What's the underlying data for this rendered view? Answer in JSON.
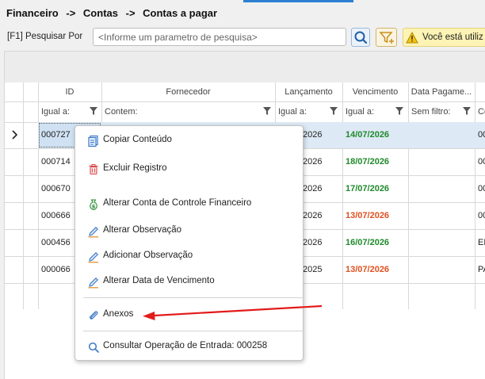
{
  "breadcrumb": {
    "part1": "Financeiro",
    "sep1": "->",
    "part2": "Contas",
    "sep2": "->",
    "part3": "Contas a pagar"
  },
  "search": {
    "label": "[F1] Pesquisar Por",
    "placeholder": "<Informe um parametro de pesquisa>",
    "value": ""
  },
  "toolbar": {
    "search_icon": "search-icon",
    "filter_icon": "filter-add-icon"
  },
  "warning": {
    "icon": "warning-icon",
    "text": "Você está utiliz"
  },
  "grid": {
    "headers": [
      "ID",
      "Fornecedor",
      "Lançamento",
      "Vencimento",
      "Data Pagame...",
      ""
    ],
    "filters": [
      "Igual a:",
      "Contem:",
      "Igual a:",
      "Igual a:",
      "Sem filtro:",
      "Co"
    ],
    "rows": [
      {
        "id": "000727",
        "lancamento": "2026",
        "vencimento": "14/07/2026",
        "venc_status": "green",
        "extra": "00"
      },
      {
        "id": "000714",
        "lancamento": "2026",
        "vencimento": "18/07/2026",
        "venc_status": "green",
        "extra": "00"
      },
      {
        "id": "000670",
        "lancamento": "2026",
        "vencimento": "17/07/2026",
        "venc_status": "green",
        "extra": "00"
      },
      {
        "id": "000666",
        "lancamento": "2026",
        "vencimento": "13/07/2026",
        "venc_status": "orange",
        "extra": "00"
      },
      {
        "id": "000456",
        "lancamento": "2026",
        "vencimento": "16/07/2026",
        "venc_status": "green",
        "extra": "EN"
      },
      {
        "id": "000066",
        "lancamento": "2025",
        "vencimento": "13/07/2026",
        "venc_status": "orange",
        "extra": "PA"
      }
    ]
  },
  "context_menu": {
    "items": [
      {
        "label": "Copiar Conteúdo",
        "icon": "copy-icon"
      },
      {
        "label": "Excluir Registro",
        "icon": "trash-icon"
      },
      {
        "label": "Alterar Conta de Controle Financeiro",
        "icon": "money-bag-icon"
      },
      {
        "label": "Alterar Observação",
        "icon": "pencil-icon"
      },
      {
        "label": "Adicionar Observação",
        "icon": "pencil-icon"
      },
      {
        "label": "Alterar Data de Vencimento",
        "icon": "pencil-icon"
      },
      {
        "label": "Anexos",
        "icon": "paperclip-icon"
      },
      {
        "label": "Consultar Operação de Entrada: 000258",
        "icon": "search-icon"
      }
    ]
  },
  "colors": {
    "accent": "#2c7fd1",
    "due_green": "#1f8a2b",
    "due_orange": "#e0501f",
    "annotation_arrow": "#e31b1b",
    "selection": "#dde9f4"
  }
}
